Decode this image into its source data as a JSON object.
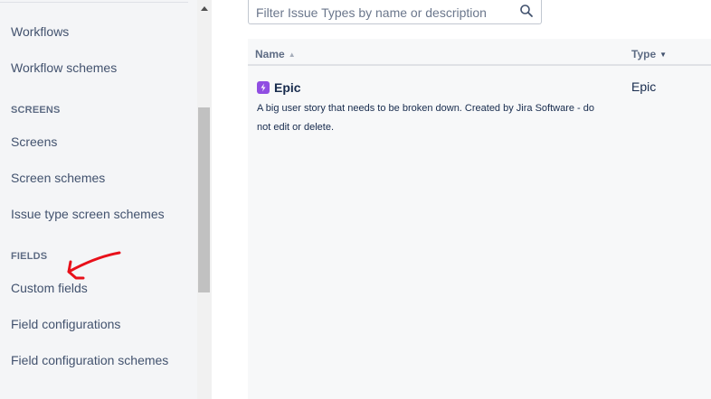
{
  "sidebar": {
    "items": [
      {
        "label": "Workflows"
      },
      {
        "label": "Workflow schemes"
      },
      {
        "label": "SCREENS"
      },
      {
        "label": "Screens"
      },
      {
        "label": "Screen schemes"
      },
      {
        "label": "Issue type screen schemes"
      },
      {
        "label": "FIELDS"
      },
      {
        "label": "Custom fields"
      },
      {
        "label": "Field configurations"
      },
      {
        "label": "Field configuration schemes"
      }
    ]
  },
  "filter": {
    "placeholder": "Filter Issue Types by name or description",
    "icon": "search-icon"
  },
  "table": {
    "columns": [
      {
        "label": "Name"
      },
      {
        "label": "Type"
      }
    ],
    "rows": [
      {
        "icon": "epic-lightning-icon",
        "name": "Epic",
        "description": "A big user story that needs to be broken down. Created by Jira Software - do not edit or delete.",
        "type": "Epic"
      }
    ]
  },
  "colors": {
    "epic": "#904ee2",
    "annotation": "#e8101a",
    "sidebar_bg": "#f4f5f7"
  }
}
